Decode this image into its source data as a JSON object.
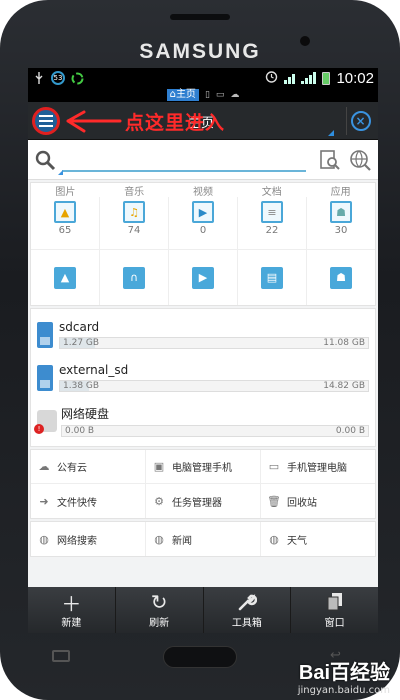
{
  "device": {
    "brand": "SAMSUNG"
  },
  "status": {
    "time": "10:02",
    "notification_count": "53"
  },
  "switcher": {
    "home_label": "主页"
  },
  "titlebar": {
    "title": "主页",
    "annotation": "点这里进入"
  },
  "search": {
    "placeholder": "",
    "value": ""
  },
  "categories": {
    "headers": [
      "图片",
      "音乐",
      "视频",
      "文档",
      "应用"
    ],
    "counts": [
      "65",
      "74",
      "0",
      "22",
      "30"
    ]
  },
  "storage": [
    {
      "name": "sdcard",
      "used": "1.27 GB",
      "total": "11.08 GB",
      "fraction": 0.115
    },
    {
      "name": "external_sd",
      "used": "1.38 GB",
      "total": "14.82 GB",
      "fraction": 0.093
    },
    {
      "name": "网络硬盘",
      "used": "0.00 B",
      "total": "0.00 B",
      "fraction": 0.0
    }
  ],
  "tools": [
    [
      "公有云",
      "电脑管理手机",
      "手机管理电脑"
    ],
    [
      "文件快传",
      "任务管理器",
      "回收站"
    ],
    [
      "网络搜索",
      "新闻",
      "天气"
    ]
  ],
  "bottombar": [
    "新建",
    "刷新",
    "工具箱",
    "窗口"
  ],
  "watermark": {
    "logo": "Bai百经验",
    "url": "jingyan.baidu.com"
  },
  "colors": {
    "accent": "#3a93e0",
    "annotation_red": "#ff2a2a",
    "titlebar": "#26292c"
  }
}
